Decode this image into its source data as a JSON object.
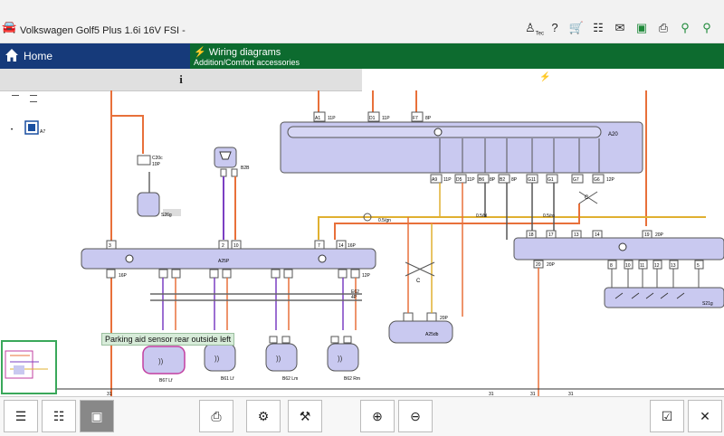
{
  "header": {
    "title": "Volkswagen Golf5 Plus 1.6i 16V FSI -",
    "icons": [
      "car-icon",
      "user-icon",
      "help-icon",
      "cart-icon",
      "tree-icon",
      "mail-icon",
      "battery-icon",
      "print-icon",
      "network-icon",
      "network2-icon"
    ],
    "user_badge": "Tec"
  },
  "nav": {
    "home_label": "Home",
    "section_title": "Wiring diagrams",
    "section_subtitle": "Addition/Comfort accessories"
  },
  "info": {
    "label": "i"
  },
  "tooltip": "Parking aid sensor rear outside left",
  "colors": {
    "home": "#163a7a",
    "section": "#0d6b2f",
    "component": "#c9c9f0",
    "wire_orange": "#e8703a",
    "wire_purple": "#7b3fc2",
    "wire_yellow": "#e0b030"
  },
  "diagram": {
    "components": [
      "A1 11P",
      "D1 11P",
      "F7 8P",
      "A20",
      "A9 11P",
      "D5 11P",
      "B6 8P",
      "B2 8P",
      "G11",
      "G1",
      "G7",
      "G6 12P",
      "C20c 10P",
      "S26g",
      "B2B",
      "A25P",
      "12P",
      "16P",
      "2P",
      "E62 4P",
      "B67",
      "B61",
      "B62",
      "A25db",
      "B2 20P",
      "S21g",
      "C",
      "20P"
    ],
    "pins_a25p": [
      "3",
      "2",
      "10",
      "7",
      "14",
      "16P",
      "12P"
    ],
    "pins_right": [
      "18",
      "17",
      "13",
      "14",
      "19",
      "20P",
      "20",
      "8",
      "10",
      "11",
      "12",
      "13",
      "14",
      "15"
    ],
    "sensors": [
      "B67 Lf",
      "B61 Lf",
      "B62 Lm",
      "B62 Rm"
    ]
  },
  "toolbar": {
    "buttons": [
      "list-icon",
      "list2-icon",
      "fit-icon",
      "print-icon",
      "settings-icon",
      "tools-icon",
      "zoom-in-icon",
      "zoom-out-icon",
      "checklist-icon",
      "close-icon"
    ]
  }
}
